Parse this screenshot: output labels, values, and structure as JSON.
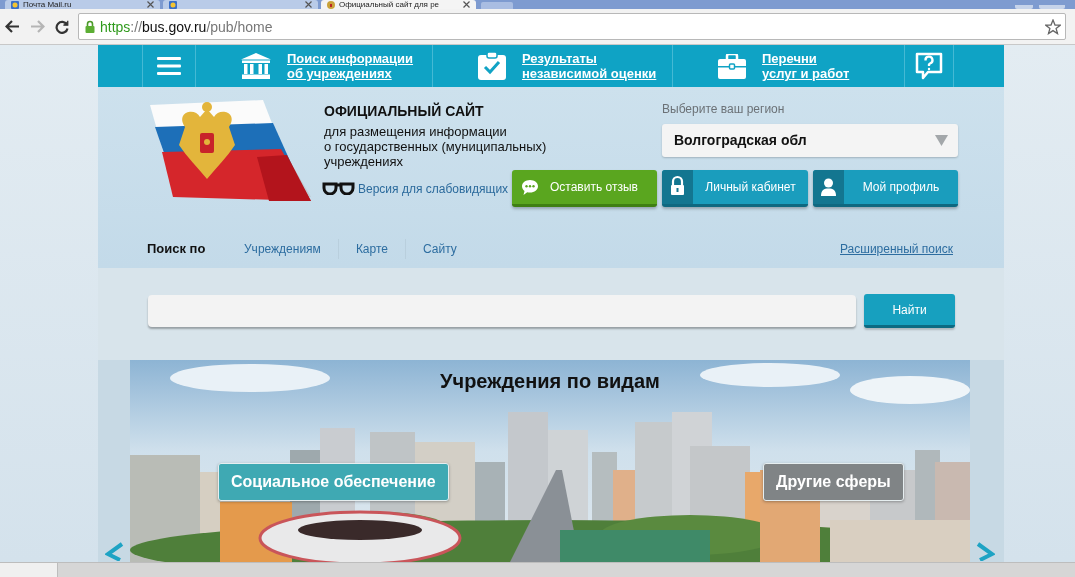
{
  "browser": {
    "tabs": [
      {
        "title": "Почта Mail.ru",
        "selected": false
      },
      {
        "selected": false
      },
      {
        "title": "Официальный сайт для ре",
        "selected": true
      }
    ],
    "forward_disabled": true,
    "url": {
      "scheme": "https",
      "separator": "://",
      "host": "bus.gov.ru",
      "path": "/pub/home"
    }
  },
  "nav": {
    "links": [
      {
        "kind": "institutions",
        "lines": [
          "Поиск информации",
          "об учреждениях"
        ]
      },
      {
        "kind": "results",
        "lines": [
          "Результаты",
          "независимой оценки"
        ]
      },
      {
        "kind": "services",
        "lines": [
          "Перечни",
          "услуг и работ"
        ]
      }
    ]
  },
  "header": {
    "title": "ОФИЦИАЛЬНЫЙ САЙТ",
    "subtitle_lines": [
      "для размещения информации",
      "о государственных (муниципальных)",
      "учреждениях"
    ],
    "accessibility_link": "Версия для слабовидящих",
    "region": {
      "label": "Выберите ваш регион",
      "value": "Волгоградская обл"
    },
    "buttons": [
      {
        "kind": "feedback",
        "label": "Оставить отзыв"
      },
      {
        "kind": "cabinet",
        "label": "Личный кабинет"
      },
      {
        "kind": "profile",
        "label": "Мой профиль"
      }
    ]
  },
  "search_by": {
    "label": "Поиск по",
    "tabs": [
      {
        "label": "Учреждениям",
        "selected": false
      },
      {
        "label": "Карте",
        "selected": false
      },
      {
        "label": "Сайту",
        "selected": false
      }
    ],
    "advanced_link": "Расширенный поиск"
  },
  "search": {
    "button": "Найти"
  },
  "banner": {
    "title": "Учреждения по видам",
    "tags": [
      {
        "label": "Социальное обеспечение",
        "color": "#3fa9b3"
      },
      {
        "label": "Другие сферы",
        "color": "#808486"
      }
    ]
  }
}
